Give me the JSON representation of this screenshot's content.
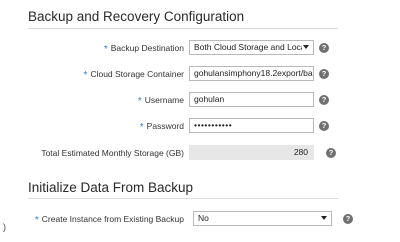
{
  "backup_section": {
    "title": "Backup and Recovery Configuration",
    "fields": {
      "backup_destination": {
        "label": "Backup Destination",
        "value": "Both Cloud Storage and Loca"
      },
      "cloud_storage_container": {
        "label": "Cloud Storage Container",
        "value": "gohulansimphony18.2export/bac"
      },
      "username": {
        "label": "Username",
        "value": "gohulan"
      },
      "password": {
        "label": "Password",
        "value": "•••••••••••"
      },
      "total_storage": {
        "label": "Total Estimated Monthly Storage (GB)",
        "value": "280"
      }
    },
    "required_marker": "*"
  },
  "initialize_section": {
    "title": "Initialize Data From Backup",
    "fields": {
      "create_instance": {
        "label": "Create Instance from Existing Backup",
        "value": "No"
      }
    }
  },
  "help_glyph": "?",
  "left_edge_glyph": ")",
  "colors": {
    "required_asterisk": "#3d7fbf",
    "help_icon_bg": "#707070",
    "readonly_bg": "#e7e7e7",
    "border": "#b9b9b9"
  }
}
